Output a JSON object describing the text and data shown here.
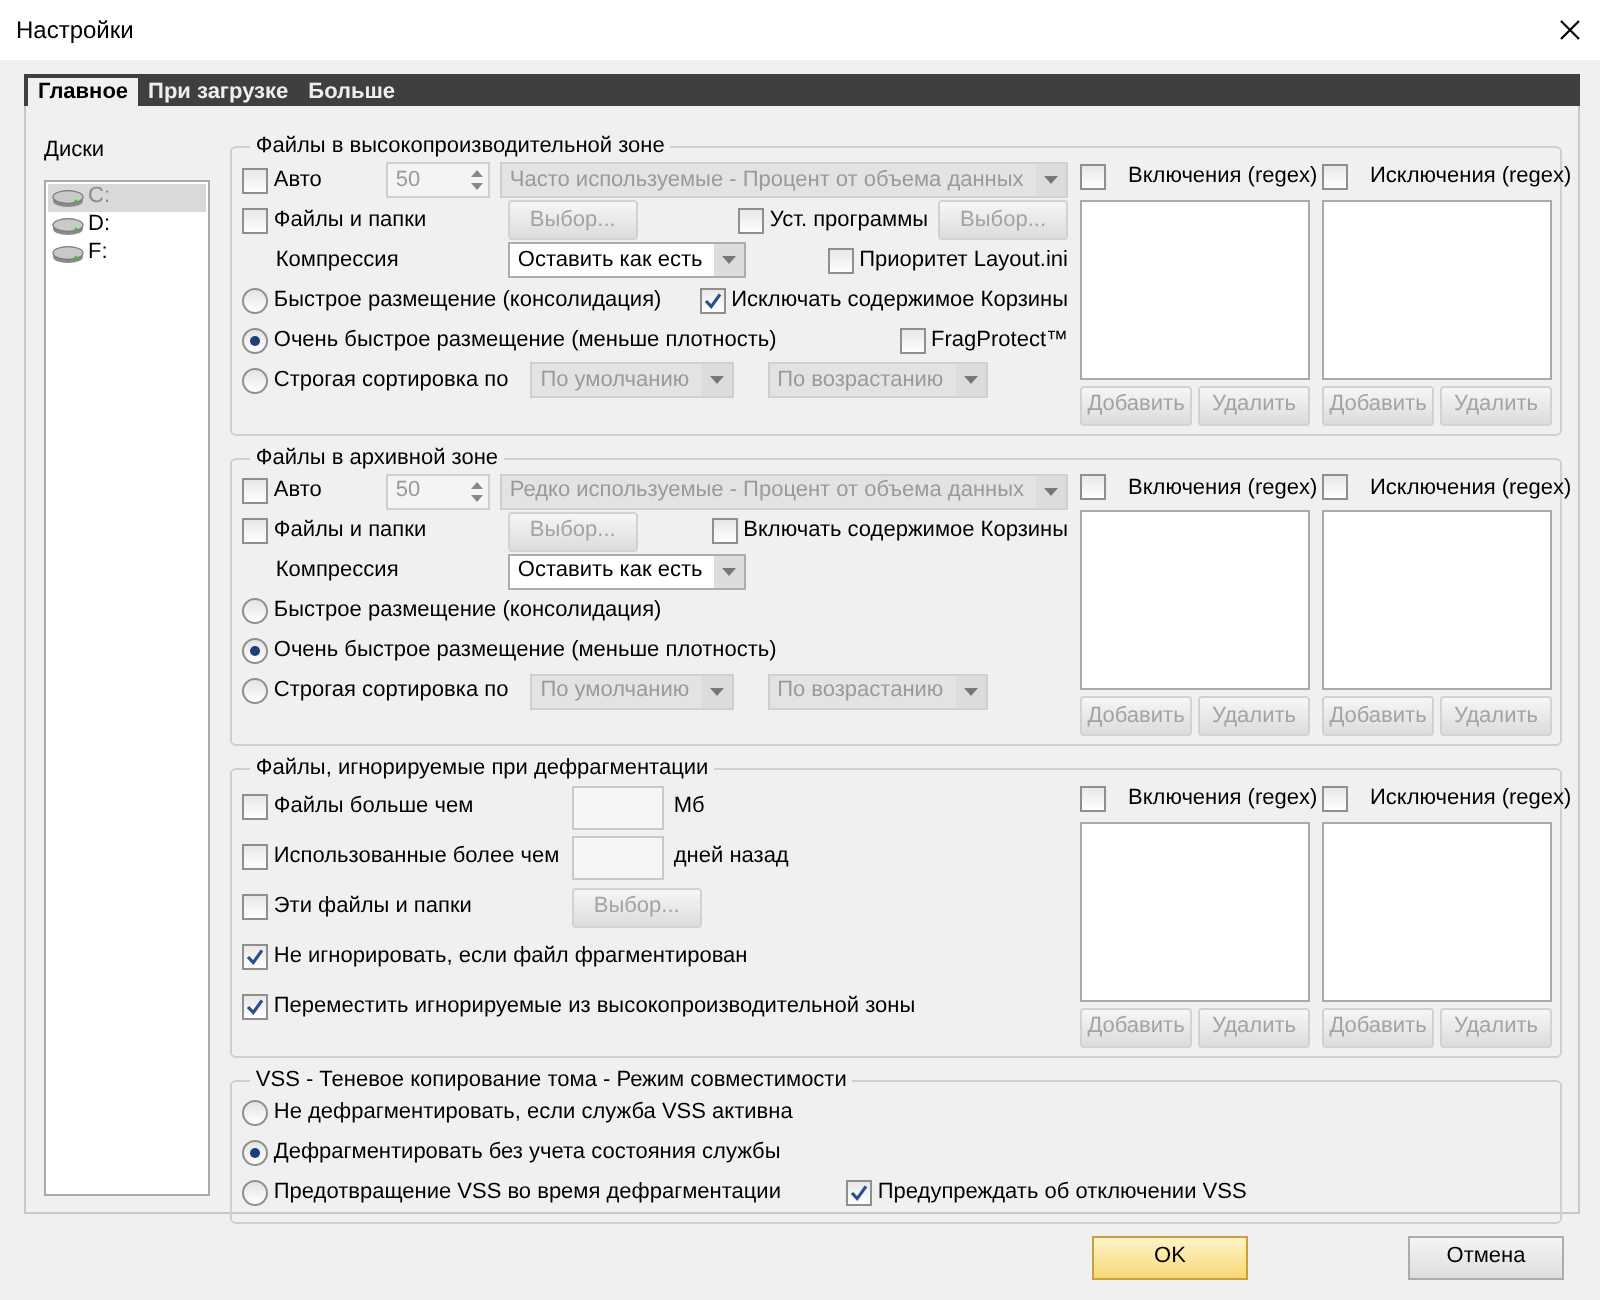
{
  "window": {
    "title": "Настройки"
  },
  "tabs": [
    {
      "label": "Главное",
      "selected": true
    },
    {
      "label": "При загрузке",
      "selected": false
    },
    {
      "label": "Больше",
      "selected": false
    }
  ],
  "disks": {
    "label": "Диски",
    "items": [
      {
        "label": "C:",
        "selected": true
      },
      {
        "label": "D:",
        "selected": false
      },
      {
        "label": "F:",
        "selected": false
      }
    ]
  },
  "groups": [
    {
      "kind": "zone",
      "title": "Файлы в высокопроизводительной зоне",
      "rows": [
        {
          "left": [
            {
              "kind": "checkbox",
              "label": "Авто",
              "checked": false
            },
            {
              "kind": "spin",
              "value": "50",
              "disabled": true
            },
            {
              "kind": "select",
              "value": "Часто используемые - Процент от объема данных",
              "disabled": true
            }
          ]
        },
        {
          "left": [
            {
              "kind": "checkbox",
              "label": "Файлы и папки",
              "checked": false
            },
            {
              "kind": "button",
              "label": "Выбор...",
              "disabled": true
            }
          ],
          "right": [
            {
              "kind": "checkbox",
              "label": "Уст. программы",
              "checked": false
            },
            {
              "kind": "button",
              "label": "Выбор...",
              "disabled": true
            }
          ]
        },
        {
          "left": [
            {
              "kind": "text",
              "label": "Компрессия"
            },
            {
              "kind": "select",
              "value": "Оставить как есть",
              "disabled": false
            }
          ],
          "right": [
            {
              "kind": "checkbox",
              "label": "Приоритет Layout.ini",
              "checked": false
            }
          ]
        },
        {
          "left": [
            {
              "kind": "radio",
              "label": "Быстрое размещение (консолидация)",
              "selected": false
            }
          ],
          "right": [
            {
              "kind": "checkbox",
              "label": "Исключать содержимое Корзины",
              "checked": true
            }
          ]
        },
        {
          "left": [
            {
              "kind": "radio",
              "label": "Очень быстрое размещение (меньше плотность)",
              "selected": true
            }
          ],
          "right": [
            {
              "kind": "checkbox",
              "label": "FragProtect™",
              "checked": false
            }
          ]
        },
        {
          "left": [
            {
              "kind": "radio",
              "label": "Строгая сортировка по",
              "selected": false
            },
            {
              "kind": "select",
              "value": "По умолчанию",
              "disabled": true
            },
            {
              "kind": "select",
              "value": "По возрастанию",
              "disabled": true
            }
          ]
        }
      ],
      "regex": [
        {
          "label": "Включения (regex)",
          "checked": false,
          "buttons": [
            {
              "label": "Добавить",
              "disabled": true
            },
            {
              "label": "Удалить",
              "disabled": true
            }
          ]
        },
        {
          "label": "Исключения (regex)",
          "checked": false,
          "buttons": [
            {
              "label": "Добавить",
              "disabled": true
            },
            {
              "label": "Удалить",
              "disabled": true
            }
          ]
        }
      ]
    },
    {
      "kind": "zone",
      "title": "Файлы в архивной зоне",
      "rows": [
        {
          "left": [
            {
              "kind": "checkbox",
              "label": "Авто",
              "checked": false
            },
            {
              "kind": "spin",
              "value": "50",
              "disabled": true
            },
            {
              "kind": "select",
              "value": "Редко используемые - Процент от объема данных",
              "disabled": true
            }
          ]
        },
        {
          "left": [
            {
              "kind": "checkbox",
              "label": "Файлы и папки",
              "checked": false
            },
            {
              "kind": "button",
              "label": "Выбор...",
              "disabled": true
            }
          ],
          "right": [
            {
              "kind": "checkbox",
              "label": "Включать содержимое Корзины",
              "checked": false
            }
          ]
        },
        {
          "left": [
            {
              "kind": "text",
              "label": "Компрессия"
            },
            {
              "kind": "select",
              "value": "Оставить как есть",
              "disabled": false
            }
          ]
        },
        {
          "left": [
            {
              "kind": "radio",
              "label": "Быстрое размещение (консолидация)",
              "selected": false
            }
          ]
        },
        {
          "left": [
            {
              "kind": "radio",
              "label": "Очень быстрое размещение (меньше плотность)",
              "selected": true
            }
          ]
        },
        {
          "left": [
            {
              "kind": "radio",
              "label": "Строгая сортировка по",
              "selected": false
            },
            {
              "kind": "select",
              "value": "По умолчанию",
              "disabled": true
            },
            {
              "kind": "select",
              "value": "По возрастанию",
              "disabled": true
            }
          ]
        }
      ],
      "regex": [
        {
          "label": "Включения (regex)",
          "checked": false,
          "buttons": [
            {
              "label": "Добавить",
              "disabled": true
            },
            {
              "label": "Удалить",
              "disabled": true
            }
          ]
        },
        {
          "label": "Исключения (regex)",
          "checked": false,
          "buttons": [
            {
              "label": "Добавить",
              "disabled": true
            },
            {
              "label": "Удалить",
              "disabled": true
            }
          ]
        }
      ]
    },
    {
      "kind": "ignore",
      "title": "Файлы, игнорируемые при дефрагментации",
      "rows": [
        {
          "left": [
            {
              "kind": "checkbox",
              "label": "Файлы больше чем",
              "checked": false
            },
            {
              "kind": "field"
            },
            {
              "kind": "text",
              "label": "Мб"
            }
          ]
        },
        {
          "left": [
            {
              "kind": "checkbox",
              "label": "Использованные более чем",
              "checked": false
            },
            {
              "kind": "field"
            },
            {
              "kind": "text",
              "label": "дней назад"
            }
          ]
        },
        {
          "left": [
            {
              "kind": "checkbox",
              "label": "Эти файлы и папки",
              "checked": false
            },
            {
              "kind": "button",
              "label": "Выбор...",
              "disabled": true
            }
          ]
        },
        {
          "left": [
            {
              "kind": "checkbox",
              "label": "Не игнорировать, если файл фрагментирован",
              "checked": true
            }
          ]
        },
        {
          "left": [
            {
              "kind": "checkbox",
              "label": "Переместить игнорируемые из высокопроизводительной зоны",
              "checked": true
            }
          ]
        }
      ],
      "regex": [
        {
          "label": "Включения (regex)",
          "checked": false,
          "buttons": [
            {
              "label": "Добавить",
              "disabled": true
            },
            {
              "label": "Удалить",
              "disabled": true
            }
          ]
        },
        {
          "label": "Исключения (regex)",
          "checked": false,
          "buttons": [
            {
              "label": "Добавить",
              "disabled": true
            },
            {
              "label": "Удалить",
              "disabled": true
            }
          ]
        }
      ]
    },
    {
      "kind": "vss",
      "title": "VSS - Теневое копирование тома - Режим совместимости",
      "rows": [
        {
          "left": [
            {
              "kind": "radio",
              "label": "Не дефрагментировать, если служба VSS активна",
              "selected": false
            }
          ]
        },
        {
          "left": [
            {
              "kind": "radio",
              "label": "Дефрагментировать без учета состояния службы",
              "selected": true
            }
          ]
        },
        {
          "left": [
            {
              "kind": "radio",
              "label": "Предотвращение VSS во время дефрагментации",
              "selected": false
            }
          ],
          "right": [
            {
              "kind": "checkbox",
              "label": "Предупреждать об отключении VSS",
              "checked": true
            }
          ]
        }
      ]
    }
  ],
  "footer": [
    {
      "label": "OK",
      "default": true
    },
    {
      "label": "Отмена",
      "default": false
    }
  ]
}
